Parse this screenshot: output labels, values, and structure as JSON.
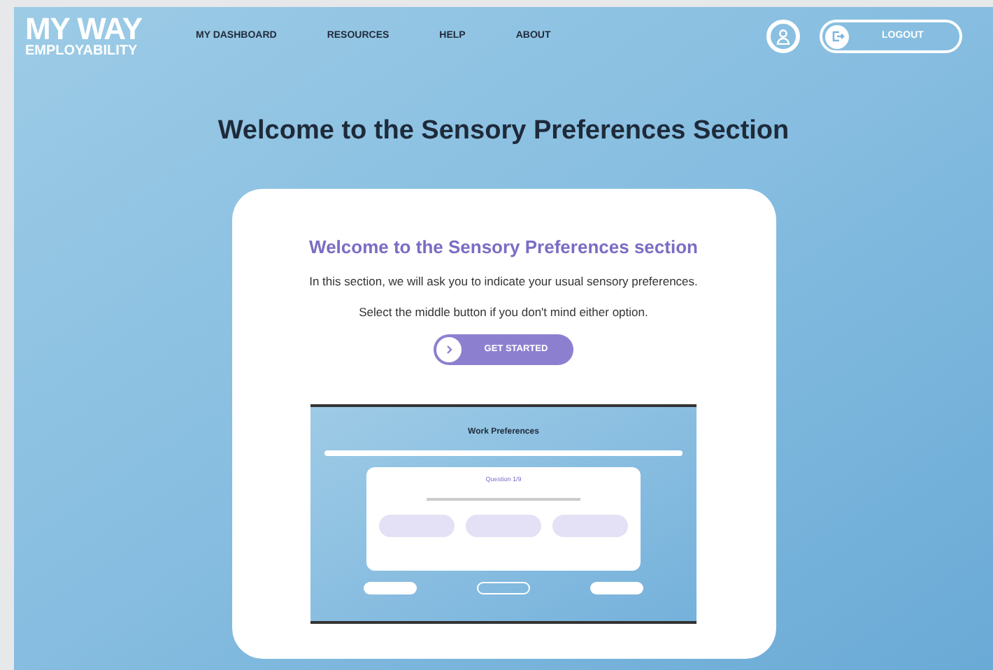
{
  "logo": {
    "top": "MY WAY",
    "bottom": "EMPLOYABILITY"
  },
  "nav": [
    {
      "label": "MY DASHBOARD"
    },
    {
      "label": "RESOURCES"
    },
    {
      "label": "HELP"
    },
    {
      "label": "ABOUT"
    }
  ],
  "logout": {
    "label": "LOGOUT"
  },
  "page_title": "Welcome to the Sensory Preferences Section",
  "card": {
    "title": "Welcome to the Sensory Preferences section",
    "lines": [
      "In this section, we will ask you to indicate your usual sensory preferences.",
      "Select the middle button if you don't mind either option."
    ],
    "button": "GET STARTED",
    "preview": {
      "title": "Work Preferences",
      "question": "Question 1/9"
    }
  }
}
